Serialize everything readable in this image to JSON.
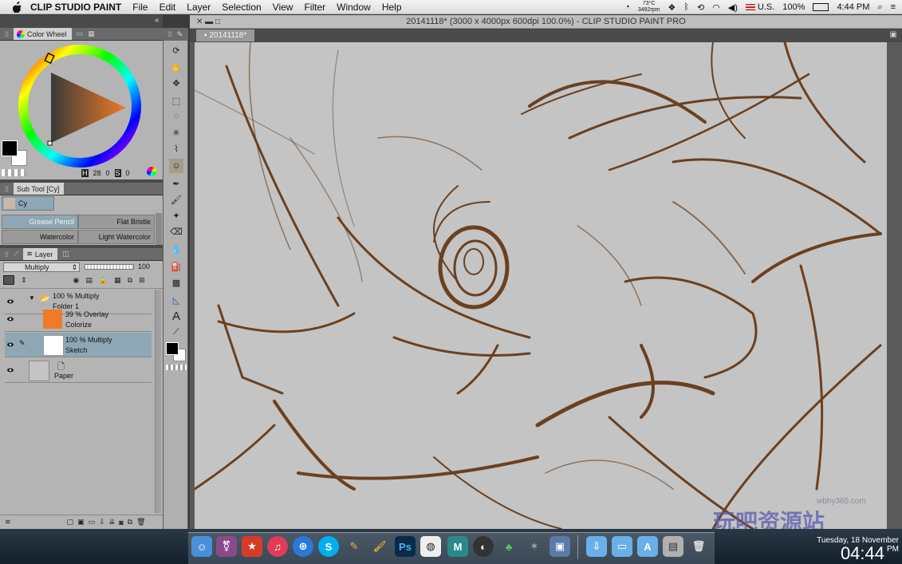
{
  "menubar": {
    "app_name": "CLIP STUDIO PAINT",
    "menus": [
      "File",
      "Edit",
      "Layer",
      "Selection",
      "View",
      "Filter",
      "Window",
      "Help"
    ],
    "temperature": "73°C",
    "fan_speed": "3492rpm",
    "input_source": "U.S.",
    "battery": "100%",
    "time": "4:44 PM"
  },
  "window": {
    "title": "20141118* (3000 x 4000px 600dpi 100.0%)  - CLIP STUDIO PAINT PRO",
    "tab": "20141118*"
  },
  "color_panel": {
    "tab_label": "Color Wheel",
    "h_label": "H",
    "h_value": "28",
    "s_label": "S",
    "s_value": "0",
    "v_label": "0",
    "v_value": "0"
  },
  "subtool": {
    "header": "Sub Tool [Cy]",
    "group": "Cy",
    "brushes": [
      "Grease Pencil",
      "Flat Bristle",
      "Watercolor",
      "Light Watercolor"
    ]
  },
  "layer_panel": {
    "tab_label": "Layer",
    "blend_mode": "Multiply",
    "opacity": "100",
    "layers": [
      {
        "line1": "100 % Multiply",
        "line2": "Folder 1"
      },
      {
        "line1": "39 % Overlay",
        "line2": "Colorize"
      },
      {
        "line1": "100 % Multiply",
        "line2": "Sketch"
      },
      {
        "line1": "",
        "line2": "Paper"
      }
    ]
  },
  "clock": {
    "date": "Tuesday, 18 November",
    "time": "04:44",
    "ampm": "PM"
  },
  "watermark": {
    "site": "wbhy365.com",
    "text": "玩吧资源站"
  },
  "colors": {
    "accent_orange": "#f07a26",
    "selection_blue": "#8fa7b4",
    "sketch_brown": "#6b4020"
  }
}
